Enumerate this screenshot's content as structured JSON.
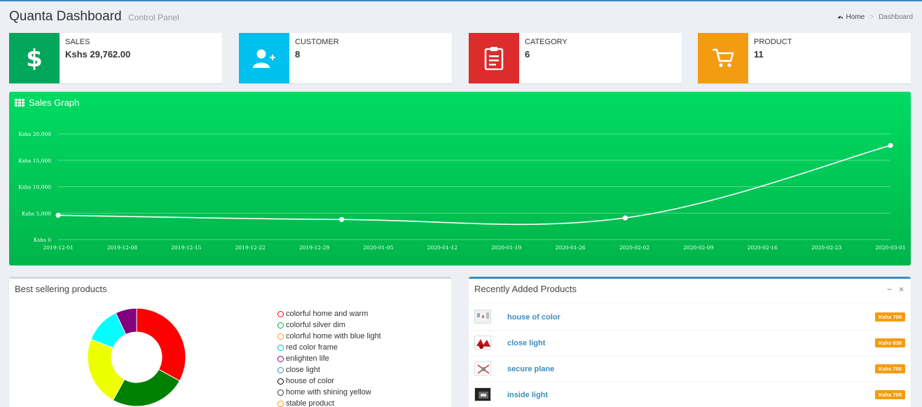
{
  "header": {
    "title": "Quanta Dashboard",
    "subtitle": "Control Panel",
    "breadcrumb_home": "Home",
    "breadcrumb_current": "Dashboard"
  },
  "info_boxes": [
    {
      "label": "SALES",
      "value": "Kshs 29,762.00",
      "color": "#00a65a",
      "icon": "dollar-icon"
    },
    {
      "label": "CUSTOMER",
      "value": "8",
      "color": "#00c0ef",
      "icon": "user-add-icon"
    },
    {
      "label": "CATEGORY",
      "value": "6",
      "color": "#dd2c2c",
      "icon": "clipboard-icon"
    },
    {
      "label": "PRODUCT",
      "value": "11",
      "color": "#f39c12",
      "icon": "cart-icon"
    }
  ],
  "graph": {
    "title": "Sales Graph"
  },
  "chart_data": {
    "type": "line",
    "title": "Sales Graph",
    "x_ticks": [
      "2019-12-01",
      "2019-12-08",
      "2019-12-15",
      "2019-12-22",
      "2019-12-29",
      "2020-01-05",
      "2020-01-12",
      "2020-01-19",
      "2020-01-26",
      "2020-02-02",
      "2020-02-09",
      "2020-02-16",
      "2020-02-23",
      "2020-03-01"
    ],
    "y_ticks": [
      "Kshs 0",
      "Kshs 5,000",
      "Kshs 10,000",
      "Kshs 15,000",
      "Kshs 20,000"
    ],
    "ylim": [
      0,
      20000
    ],
    "xlim": [
      "2019-12-01",
      "2020-03-01"
    ],
    "series": [
      {
        "points": [
          {
            "x": "2019-12-01",
            "y": 4600
          },
          {
            "x": "2020-01-01",
            "y": 3800
          },
          {
            "x": "2020-02-01",
            "y": 4100
          },
          {
            "x": "2020-03-01",
            "y": 17800
          }
        ]
      }
    ],
    "grid": true,
    "line_color": "#ffffff"
  },
  "best_selling": {
    "title": "Best sellering products",
    "items": [
      {
        "label": "colorful home and warm",
        "color": "#ff0000"
      },
      {
        "label": "colorful silver dim",
        "color": "#00a65a"
      },
      {
        "label": "colorful home with blue light",
        "color": "#f39c12"
      },
      {
        "label": "red color frame",
        "color": "#00c0ef"
      },
      {
        "label": "enlighten life",
        "color": "#800080"
      },
      {
        "label": "close light",
        "color": "#3c8dbc"
      },
      {
        "label": "house of color",
        "color": "#000000"
      },
      {
        "label": "home with shining yellow",
        "color": "#333333"
      },
      {
        "label": "stable product",
        "color": "#f39c12"
      }
    ],
    "slices": [
      {
        "value": 33,
        "color": "#ff0000"
      },
      {
        "value": 25,
        "color": "#008000"
      },
      {
        "value": 23,
        "color": "#eeff00"
      },
      {
        "value": 12,
        "color": "#00ffff"
      },
      {
        "value": 7,
        "color": "#800080"
      }
    ]
  },
  "recent_products": {
    "title": "Recently Added Products",
    "minimize": "−",
    "close": "×",
    "items": [
      {
        "name": "house of color",
        "price": "Kshs 700"
      },
      {
        "name": "close light",
        "price": "Kshs 630"
      },
      {
        "name": "secure plane",
        "price": "Kshs 700"
      },
      {
        "name": "inside light",
        "price": "Kshs 700"
      }
    ]
  }
}
